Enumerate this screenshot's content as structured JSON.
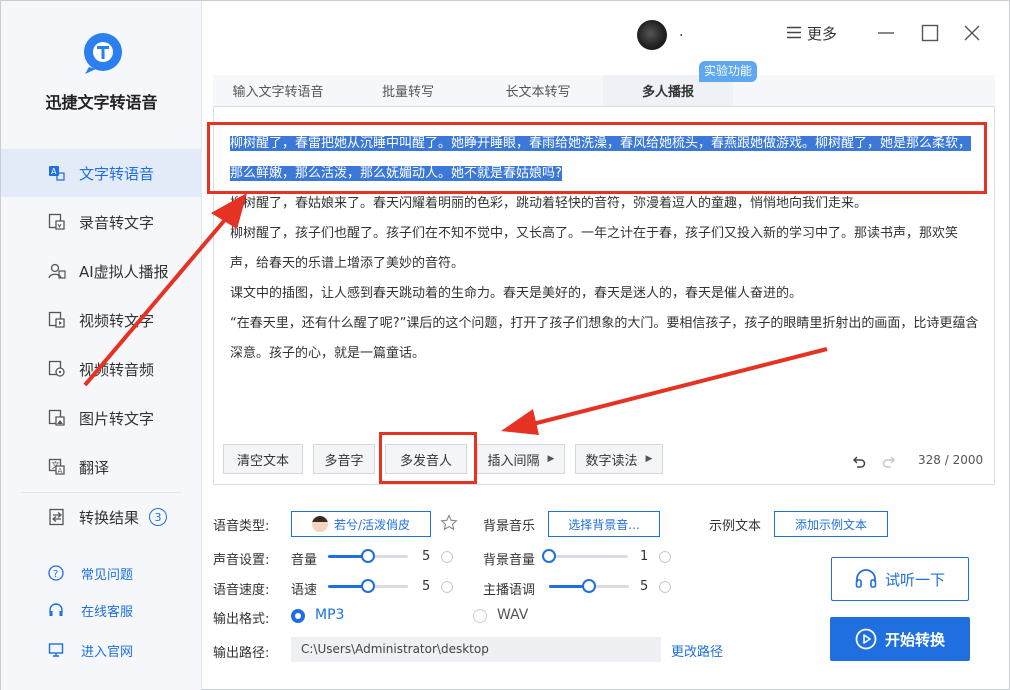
{
  "app": {
    "name": "迅捷文字转语音"
  },
  "sidebar": {
    "items": [
      {
        "label": "文字转语音"
      },
      {
        "label": "录音转文字"
      },
      {
        "label": "AI虚拟人播报"
      },
      {
        "label": "视频转文字"
      },
      {
        "label": "视频转音频"
      },
      {
        "label": "图片转文字"
      },
      {
        "label": "翻译"
      },
      {
        "label": "转换结果",
        "badge": "3"
      }
    ],
    "links": [
      {
        "label": "常见问题"
      },
      {
        "label": "在线客服"
      },
      {
        "label": "进入官网"
      }
    ]
  },
  "titlebar": {
    "username": ".",
    "more_label": "更多"
  },
  "tabs": [
    {
      "label": "输入文字转语音"
    },
    {
      "label": "批量转写"
    },
    {
      "label": "长文本转写"
    },
    {
      "label": "多人播报"
    }
  ],
  "lab_badge": "实验功能",
  "editor": {
    "highlighted": "柳树醒了，春雷把她从沉睡中叫醒了。她睁开睡眼，春雨给她洗澡，春风给她梳头，春燕跟她做游戏。柳树醒了，她是那么柔软，那么鲜嫩，那么活泼，那么妩媚动人。她不就是春姑娘吗?",
    "paragraphs": [
      "柳树醒了，春姑娘来了。春天闪耀着明丽的色彩，跳动着轻快的音符，弥漫着逗人的童趣，悄悄地向我们走来。",
      "柳树醒了，孩子们也醒了。孩子们在不知不觉中，又长高了。一年之计在于春，孩子们又投入新的学习中了。那读书声，那欢笑声，给春天的乐谱上增添了美妙的音符。",
      "课文中的插图，让人感到春天跳动着的生命力。春天是美好的，春天是迷人的，春天是催人奋进的。",
      "“在春天里，还有什么醒了呢?”课后的这个问题，打开了孩子们想象的大门。要相信孩子，孩子的眼睛里折射出的画面，比诗更蕴含深意。孩子的心，就是一篇童话。"
    ],
    "buttons": {
      "clear": "清空文本",
      "polyphone": "多音字",
      "multi_speaker": "多发音人",
      "insert_pause": "插入间隔",
      "number_reading": "数字读法"
    },
    "counter": "328 / 2000"
  },
  "settings": {
    "voice_type_label": "语音类型:",
    "voice_value": "若兮/活泼俏皮",
    "bg_music_label": "背景音乐",
    "bg_music_button": "选择背景音...",
    "example_label": "示例文本",
    "example_button": "添加示例文本",
    "sound_label": "声音设置:",
    "volume_label": "音量",
    "volume_value": "5",
    "volume_level": 0.5,
    "bg_volume_label": "背景音量",
    "bg_volume_value": "1",
    "bg_volume_level": 0.0,
    "speed_section_label": "语音速度:",
    "speed_label": "语速",
    "speed_value": "5",
    "speed_level": 0.5,
    "tone_label": "主播语调",
    "tone_value": "5",
    "tone_level": 0.5,
    "format_label": "输出格式:",
    "format_mp3": "MP3",
    "format_wav": "WAV",
    "path_label": "输出路径:",
    "path_value": "C:\\Users\\Administrator\\desktop",
    "change_path": "更改路径"
  },
  "actions": {
    "preview": "试听一下",
    "start": "开始转换"
  },
  "colors": {
    "accent": "#1f6fe0",
    "highlight": "#3c78d8",
    "annotation": "#e53222"
  }
}
